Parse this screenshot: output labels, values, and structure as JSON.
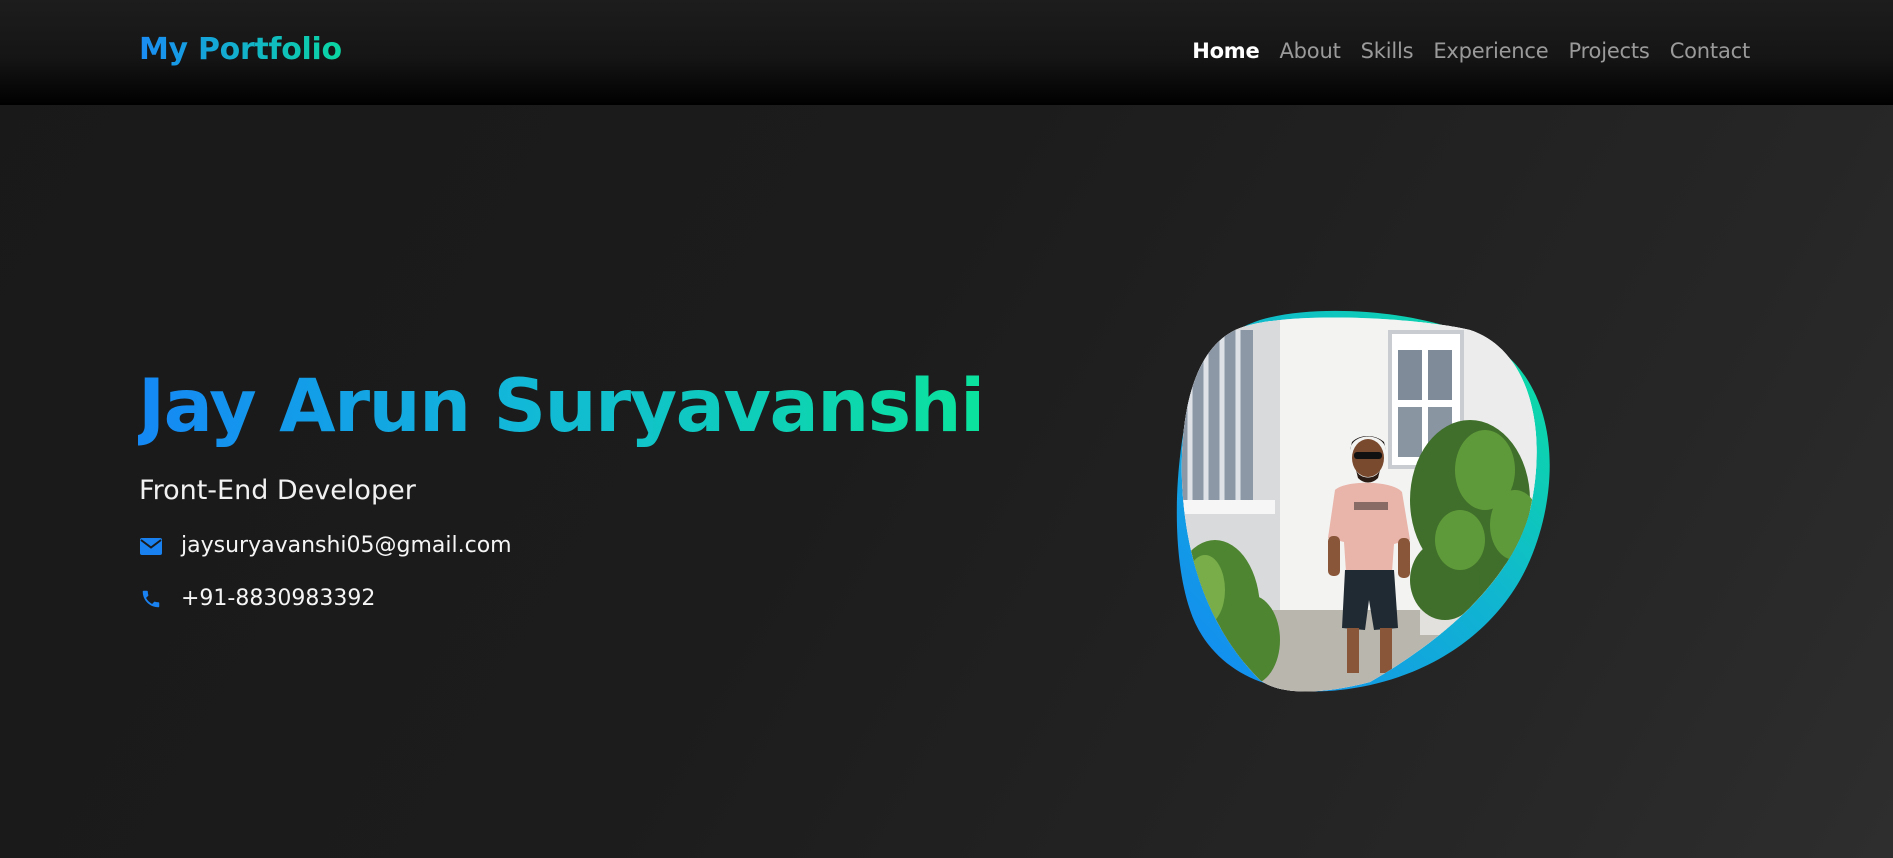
{
  "header": {
    "logo": "My Portfolio",
    "nav": [
      {
        "label": "Home",
        "active": true
      },
      {
        "label": "About",
        "active": false
      },
      {
        "label": "Skills",
        "active": false
      },
      {
        "label": "Experience",
        "active": false
      },
      {
        "label": "Projects",
        "active": false
      },
      {
        "label": "Contact",
        "active": false
      }
    ]
  },
  "hero": {
    "name": "Jay Arun Suryavanshi",
    "role": "Front-End Developer",
    "email": {
      "icon": "envelope-icon",
      "text": "jaysuryavanshi05@gmail.com"
    },
    "phone": {
      "icon": "phone-icon",
      "text": "+91-8830983392"
    },
    "photo": {
      "icon": "profile-photo"
    }
  },
  "colors": {
    "accent_blue": "#1488f5",
    "accent_green": "#0be39c",
    "background": "#1b1b1b",
    "nav_inactive": "#9a9a9a",
    "nav_active": "#ffffff"
  }
}
